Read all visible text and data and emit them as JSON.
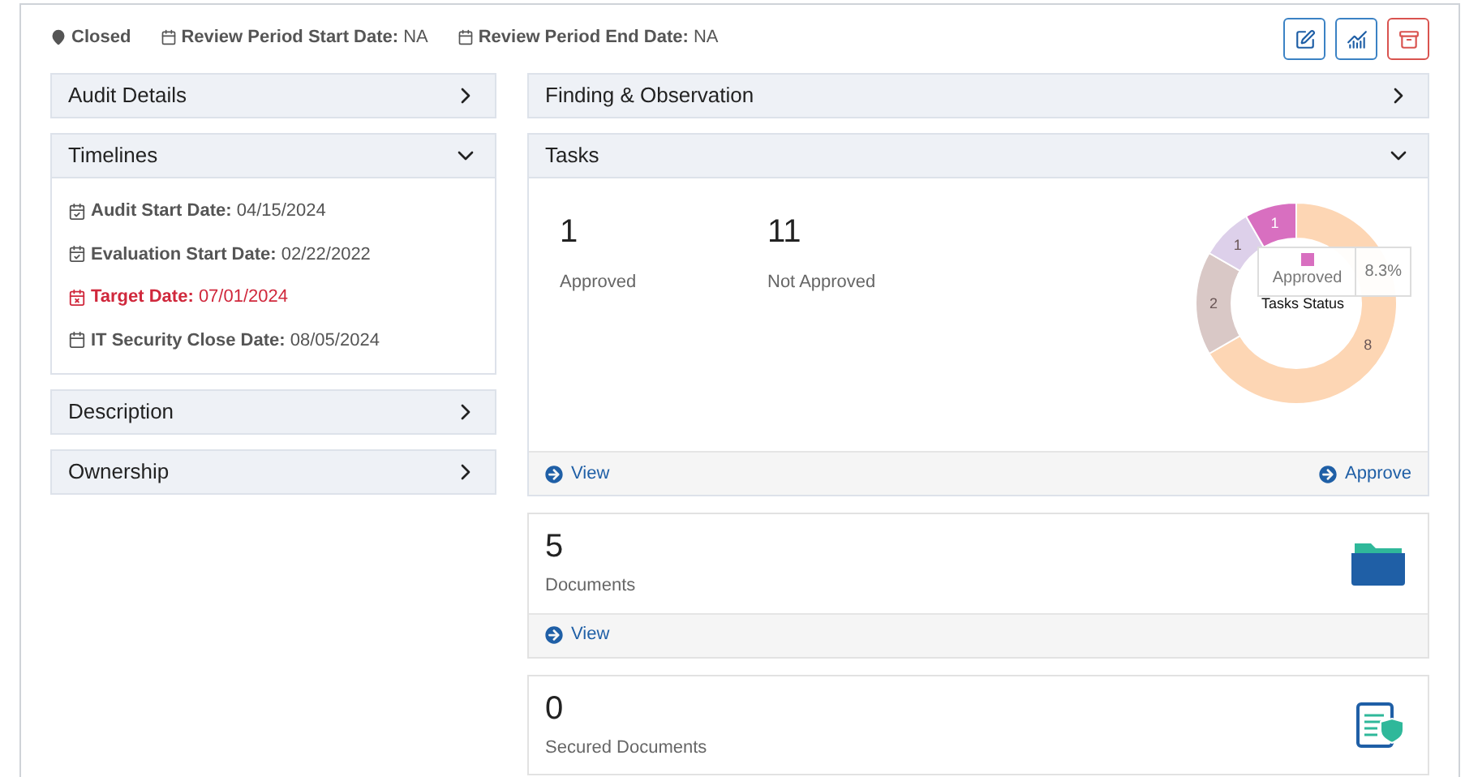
{
  "status_bar": {
    "status": "Closed",
    "items": [
      {
        "label": "Review Period Start Date:",
        "value": "NA"
      },
      {
        "label": "Review Period End Date:",
        "value": "NA"
      }
    ]
  },
  "toolbar": [
    {
      "kind": "edit"
    },
    {
      "kind": "chart"
    },
    {
      "kind": "archive"
    }
  ],
  "left_panels": [
    {
      "title": "Audit Details",
      "expanded": false
    },
    {
      "title": "Timelines",
      "expanded": true,
      "items": [
        {
          "kind": "check",
          "label": "Audit Start Date:",
          "value": "04/15/2024"
        },
        {
          "kind": "check",
          "label": "Evaluation Start Date:",
          "value": "02/22/2022"
        },
        {
          "kind": "alert",
          "label": "Target Date:",
          "value": "07/01/2024"
        },
        {
          "kind": "plain",
          "label": "IT Security Close Date:",
          "value": "08/05/2024"
        }
      ]
    },
    {
      "title": "Description",
      "expanded": false
    },
    {
      "title": "Ownership",
      "expanded": false
    }
  ],
  "findings": {
    "title": "Finding & Observation",
    "expanded": false
  },
  "tasks": {
    "title": "Tasks",
    "expanded": true,
    "stats": [
      {
        "value": "1",
        "label": "Approved"
      },
      {
        "value": "11",
        "label": "Not Approved"
      }
    ],
    "chart_data": {
      "type": "donut",
      "title": "Tasks Status",
      "values": [
        8,
        2,
        1,
        1
      ],
      "data_labels": true
    },
    "tooltip": {
      "label": "Approved",
      "value": "8.3%",
      "color": "#d86fc0"
    },
    "actions": [
      "View",
      "Approve"
    ]
  },
  "cards": [
    {
      "kind": "folder",
      "value": "5",
      "label": "Documents",
      "actions": [
        "View"
      ]
    },
    {
      "kind": "secure",
      "value": "0",
      "label": "Secured Documents"
    }
  ]
}
